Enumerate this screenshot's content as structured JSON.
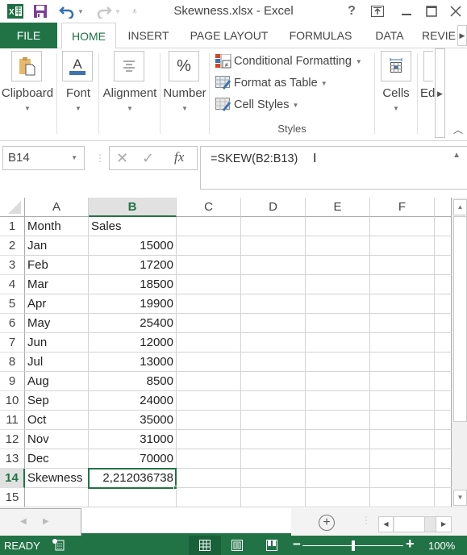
{
  "window": {
    "title": "Skewness.xlsx - Excel",
    "help_label": "?",
    "app_icon": "excel-icon",
    "qat": [
      "save-icon",
      "undo-icon",
      "redo-icon",
      "customize-qat-icon"
    ],
    "controls": [
      "ribbon-display-options-icon",
      "minimize-icon",
      "maximize-icon",
      "close-icon"
    ]
  },
  "tabs": [
    {
      "label": "FILE"
    },
    {
      "label": "HOME",
      "active": true
    },
    {
      "label": "INSERT"
    },
    {
      "label": "PAGE LAYOUT"
    },
    {
      "label": "FORMULAS"
    },
    {
      "label": "DATA"
    },
    {
      "label": "REVIE"
    }
  ],
  "ribbon": {
    "groups": [
      {
        "label": "Clipboard",
        "icon": "clipboard-icon"
      },
      {
        "label": "Font",
        "icon": "font-color-icon"
      },
      {
        "label": "Alignment",
        "icon": "align-center-icon"
      },
      {
        "label": "Number",
        "icon": "percent-icon",
        "glyph": "%"
      },
      {
        "label": "Cells",
        "icon": "cells-icon"
      },
      {
        "label": "Ed",
        "icon": "editing-icon"
      }
    ],
    "styles": {
      "group_label": "Styles",
      "items": [
        {
          "label": "Conditional Formatting",
          "icon": "conditional-formatting-icon"
        },
        {
          "label": "Format as Table",
          "icon": "format-as-table-icon"
        },
        {
          "label": "Cell Styles",
          "icon": "cell-styles-icon"
        }
      ]
    }
  },
  "formula_bar": {
    "name_box": "B14",
    "fx_label": "fx",
    "formula": "=SKEW(B2:B13)"
  },
  "sheet": {
    "columns": [
      "A",
      "B",
      "C",
      "D",
      "E",
      "F"
    ],
    "selected_column": "B",
    "selected_row": "14",
    "rows": [
      {
        "n": "1",
        "a": "Month",
        "b": "Sales",
        "b_num": false
      },
      {
        "n": "2",
        "a": "Jan",
        "b": "15000",
        "b_num": true
      },
      {
        "n": "3",
        "a": "Feb",
        "b": "17200",
        "b_num": true
      },
      {
        "n": "4",
        "a": "Mar",
        "b": "18500",
        "b_num": true
      },
      {
        "n": "5",
        "a": "Apr",
        "b": "19900",
        "b_num": true
      },
      {
        "n": "6",
        "a": "May",
        "b": "25400",
        "b_num": true
      },
      {
        "n": "7",
        "a": "Jun",
        "b": "12000",
        "b_num": true
      },
      {
        "n": "8",
        "a": "Jul",
        "b": "13000",
        "b_num": true
      },
      {
        "n": "9",
        "a": "Aug",
        "b": "8500",
        "b_num": true
      },
      {
        "n": "10",
        "a": "Sep",
        "b": "24000",
        "b_num": true
      },
      {
        "n": "11",
        "a": "Oct",
        "b": "35000",
        "b_num": true
      },
      {
        "n": "12",
        "a": "Nov",
        "b": "31000",
        "b_num": true
      },
      {
        "n": "13",
        "a": "Dec",
        "b": "70000",
        "b_num": true
      },
      {
        "n": "14",
        "a": "Skewness",
        "b": "2,212036738",
        "b_num": true
      },
      {
        "n": "15",
        "a": "",
        "b": "",
        "b_num": false
      }
    ]
  },
  "status": {
    "mode": "READY",
    "zoom": "100%",
    "zoom_minus": "−",
    "zoom_plus": "+",
    "zoom_level_pct": 100
  },
  "colors": {
    "accent": "#217346",
    "status_bar": "#217346"
  }
}
